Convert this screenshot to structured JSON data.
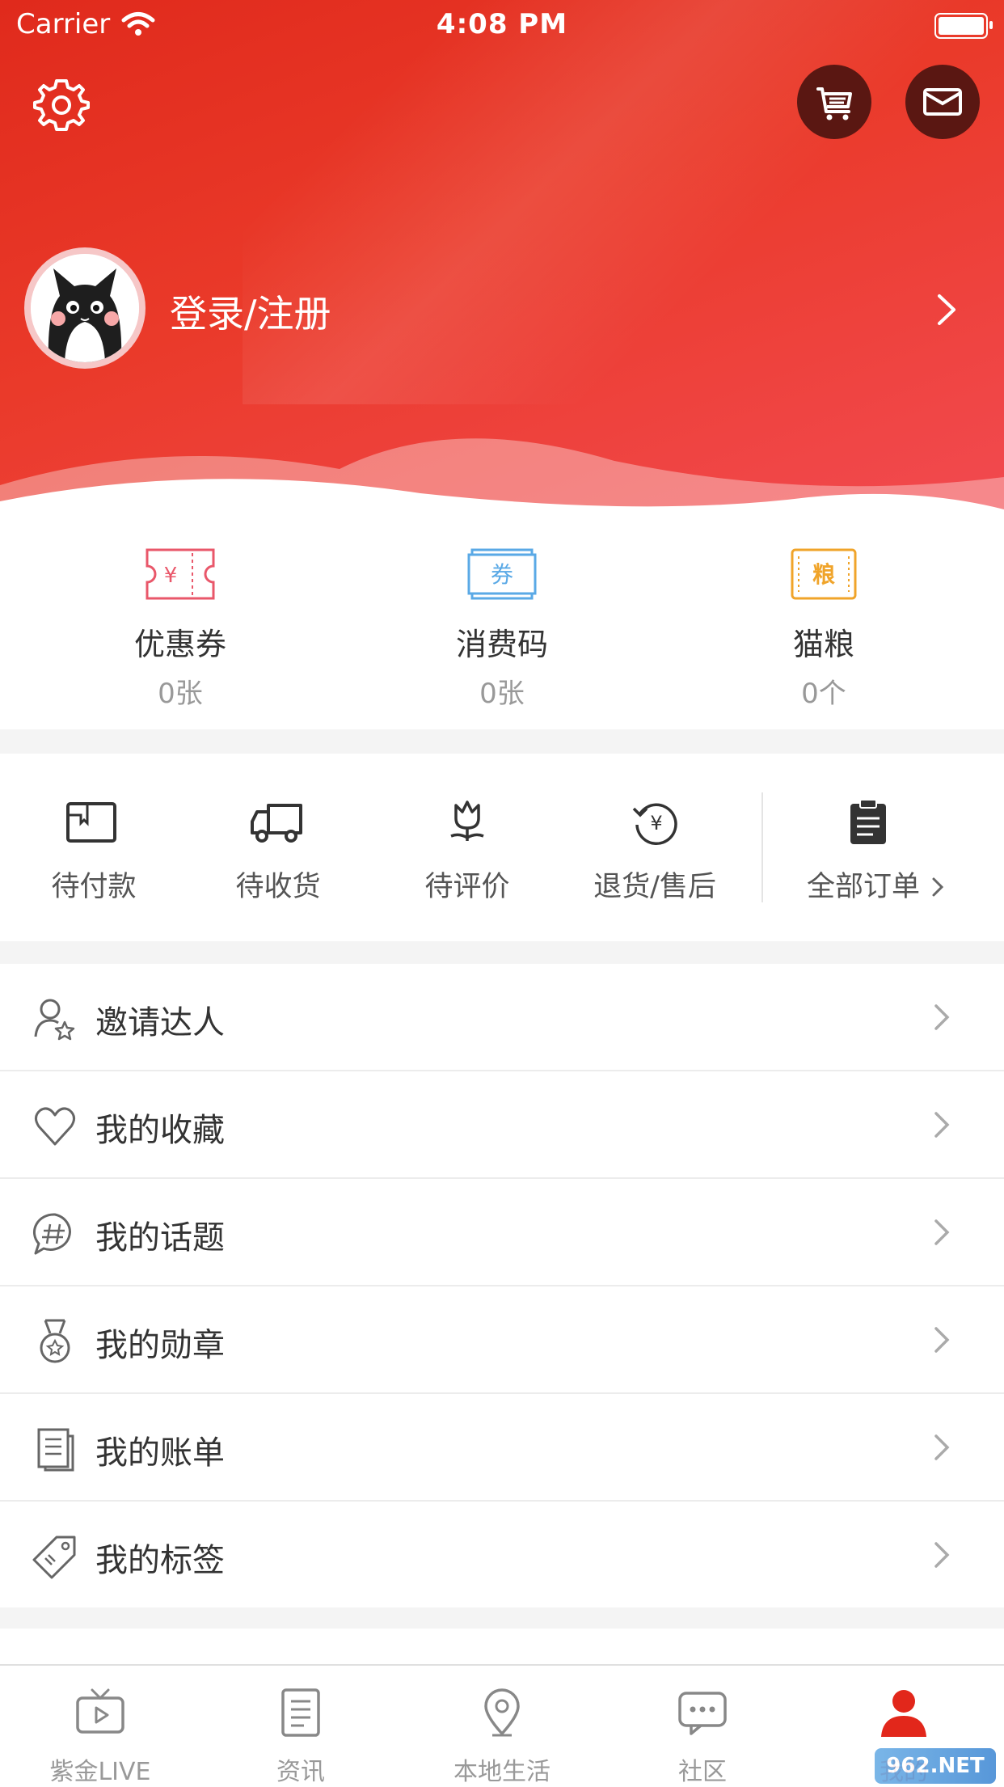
{
  "status_bar": {
    "carrier": "Carrier",
    "time": "4:08 PM"
  },
  "header": {
    "login_label": "登录/注册",
    "icons": [
      "gear-icon",
      "cart-icon",
      "mail-icon"
    ],
    "gradient_colors": [
      "#e02a1c",
      "#f24a50"
    ]
  },
  "assets": [
    {
      "label": "优惠券",
      "count": "0张",
      "icon": "coupon-icon",
      "color": "#e9576a",
      "glyph": "¥"
    },
    {
      "label": "消费码",
      "count": "0张",
      "icon": "voucher-code-icon",
      "color": "#5aa9e6",
      "glyph": "券"
    },
    {
      "label": "猫粮",
      "count": "0个",
      "icon": "cat-food-icon",
      "color": "#f0a42a",
      "glyph": "粮"
    }
  ],
  "orders": {
    "items": [
      {
        "label": "待付款",
        "icon": "wallet-icon"
      },
      {
        "label": "待收货",
        "icon": "truck-icon"
      },
      {
        "label": "待评价",
        "icon": "flower-icon"
      },
      {
        "label": "退货/售后",
        "icon": "refund-icon"
      }
    ],
    "all_label": "全部订单"
  },
  "menu": [
    {
      "label": "邀请达人",
      "icon": "user-star-icon"
    },
    {
      "label": "我的收藏",
      "icon": "heart-icon"
    },
    {
      "label": "我的话题",
      "icon": "hashtag-chat-icon"
    },
    {
      "label": "我的勋章",
      "icon": "medal-icon"
    },
    {
      "label": "我的账单",
      "icon": "bill-icon"
    },
    {
      "label": "我的标签",
      "icon": "tag-icon"
    }
  ],
  "tabbar": [
    {
      "label": "紫金LIVE",
      "icon": "tv-play-icon"
    },
    {
      "label": "资讯",
      "icon": "news-icon"
    },
    {
      "label": "本地生活",
      "icon": "location-icon"
    },
    {
      "label": "社区",
      "icon": "chat-bubble-icon"
    },
    {
      "label": "我的",
      "icon": "person-icon",
      "active": true
    }
  ],
  "accent_color": "#e2271b",
  "watermark": "962.NET"
}
